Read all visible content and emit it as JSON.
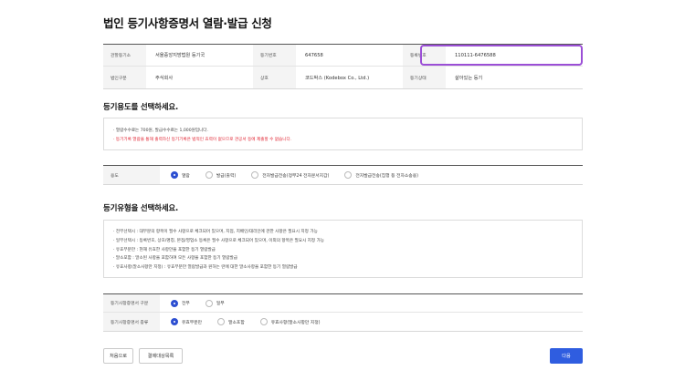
{
  "page": {
    "title": "법인 등기사항증명서 열람·발급 신청"
  },
  "info": {
    "rows": [
      [
        {
          "label": "관할등기소",
          "value": "서울중앙지방법원 등기국"
        },
        {
          "label": "등기번호",
          "value": "647658"
        },
        {
          "label": "등록번호",
          "value": "110111-6476588"
        }
      ],
      [
        {
          "label": "법인구분",
          "value": "주식회사"
        },
        {
          "label": "상호",
          "value": "코드박스 (Kodebox Co., Ltd.)"
        },
        {
          "label": "등기상태",
          "value": "살아있는 등기"
        }
      ]
    ]
  },
  "purpose": {
    "title": "등기용도를 선택하세요.",
    "notes": [
      "· 열람수수료는 700원, 발급수수료는 1,000원입니다.",
      "· 등기기록 열람을 통해 출력하신 등기기록은 법적인 효력이 없으므로 관공서 등에 제출할 수 없습니다."
    ],
    "label": "용도",
    "options": [
      "열람",
      "발급(출력)",
      "전자발급전송(정부24 전자문서지갑)",
      "전자발급전송(집행 등 전자소송용)"
    ],
    "selected_index": 0
  },
  "type": {
    "title": "등기유형을 선택하세요.",
    "notes": [
      "· 전부선택시 : 대부분의 항목이 필수 사항으로 체크되어 있으며, 지점, 지배인/대리인에 관한 사항은 필요시 지정 가능",
      "· 일부선택시 : 등록번호, 상호/명칭, 본점/영업소 등록은 필수 사항으로 체크되어 있으며, 이외의 항목은 필요시 지정 가능",
      "· 유효부분만 : 현재 유효한 사항만을 포함한 등기 열람발급",
      "· 말소포함 : 말소된 사항을 포함하여 모든 사항을 포함한 등기 열람발급",
      "· 유효사항(말소사항만 지정) : 유효부분만 열람발급과 원하는 란에 대한 말소사항을 포함한 등기 열람발급"
    ],
    "scope_label": "등기사항증명서 구분",
    "scope_options": [
      "전부",
      "일부"
    ],
    "scope_selected": 0,
    "kind_label": "등기사항증명서 종류",
    "kind_options": [
      "유효부분만",
      "말소포함",
      "유효사항(말소사항만 지정)"
    ],
    "kind_selected": 0
  },
  "buttons": {
    "first": "처음으로",
    "list": "결제대상목록",
    "next": "다음"
  },
  "colors": {
    "accent": "#2f5de0",
    "highlight": "#9b4fd6",
    "warning": "#e0212f"
  }
}
